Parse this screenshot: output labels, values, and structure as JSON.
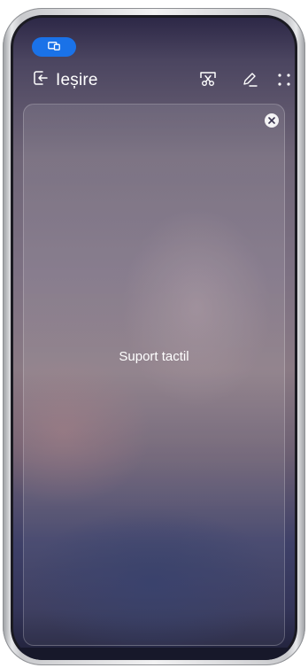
{
  "status": {
    "cast_icon": "phone-cast-icon",
    "accent_color": "#1a72e8"
  },
  "topbar": {
    "exit_label": "Ieșire",
    "exit_icon": "exit-icon",
    "tools": [
      {
        "icon": "screenshot-crop-icon"
      },
      {
        "icon": "pen-icon"
      },
      {
        "icon": "more-dots-icon"
      }
    ]
  },
  "panel": {
    "touch_label": "Suport tactil",
    "close_icon": "close-icon"
  }
}
